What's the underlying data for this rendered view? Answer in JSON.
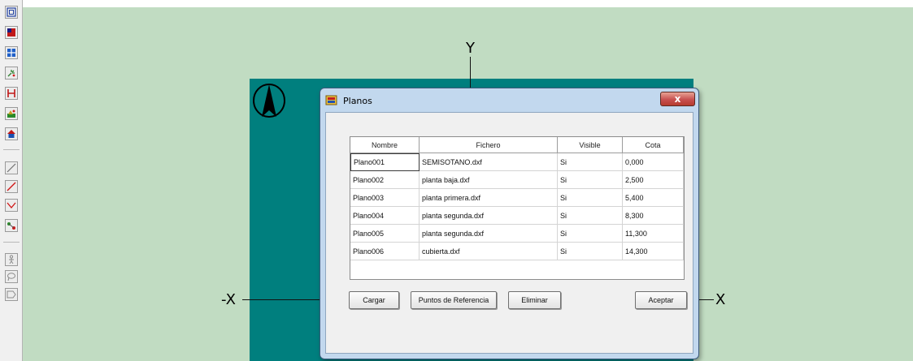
{
  "toolbar": {
    "buttons": [
      {
        "icon": "frame-select-icon"
      },
      {
        "icon": "red-block-icon"
      },
      {
        "icon": "grid-blue-icon"
      },
      {
        "icon": "sparkle-icon"
      },
      {
        "icon": "column-icon"
      },
      {
        "icon": "landscape-icon"
      },
      {
        "icon": "house-icon"
      },
      {
        "icon": "line-icon"
      },
      {
        "icon": "red-line-icon"
      },
      {
        "icon": "polyline-icon"
      },
      {
        "icon": "node-icon"
      },
      {
        "icon": "person-icon"
      },
      {
        "icon": "lasso-icon"
      },
      {
        "icon": "tag-icon"
      }
    ]
  },
  "canvas": {
    "background_color": "#c1dcc2",
    "plan_color": "#007f7e",
    "axis_y_label": "Y",
    "axis_x_neg_label": "-X",
    "axis_x_pos_label": "X",
    "north_icon": "north-arrow-icon"
  },
  "dialog": {
    "title": "Planos",
    "close_label": "x",
    "columns": [
      "Nombre",
      "Fichero",
      "Visible",
      "Cota"
    ],
    "rows": [
      [
        "Plano001",
        "SEMISOTANO.dxf",
        "Si",
        "0,000"
      ],
      [
        "Plano002",
        "planta baja.dxf",
        "Si",
        "2,500"
      ],
      [
        "Plano003",
        "planta primera.dxf",
        "Si",
        "5,400"
      ],
      [
        "Plano004",
        "planta segunda.dxf",
        "Si",
        "8,300"
      ],
      [
        "Plano005",
        "planta segunda.dxf",
        "Si",
        "11,300"
      ],
      [
        "Plano006",
        "cubierta.dxf",
        "Si",
        "14,300"
      ]
    ],
    "buttons": {
      "cargar": "Cargar",
      "puntos": "Puntos de Referencia",
      "eliminar": "Eliminar",
      "aceptar": "Aceptar"
    }
  }
}
